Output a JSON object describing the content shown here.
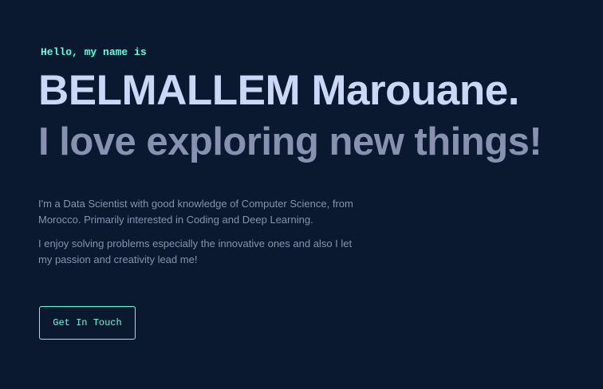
{
  "hero": {
    "greeting": "Hello, my name is",
    "name": "BELMALLEM Marouane.",
    "tagline": "I love exploring new things!",
    "bio": [
      "I'm a Data Scientist with good knowledge of Computer Science, from Morocco. Primarily interested in Coding and Deep Learning.",
      "I enjoy solving problems especially the innovative ones and also I let my passion and creativity lead me!"
    ],
    "cta_label": "Get In Touch"
  },
  "colors": {
    "background": "#0a192f",
    "accent": "#64ffda",
    "heading": "#ccd6f6",
    "text": "#8892b0"
  }
}
